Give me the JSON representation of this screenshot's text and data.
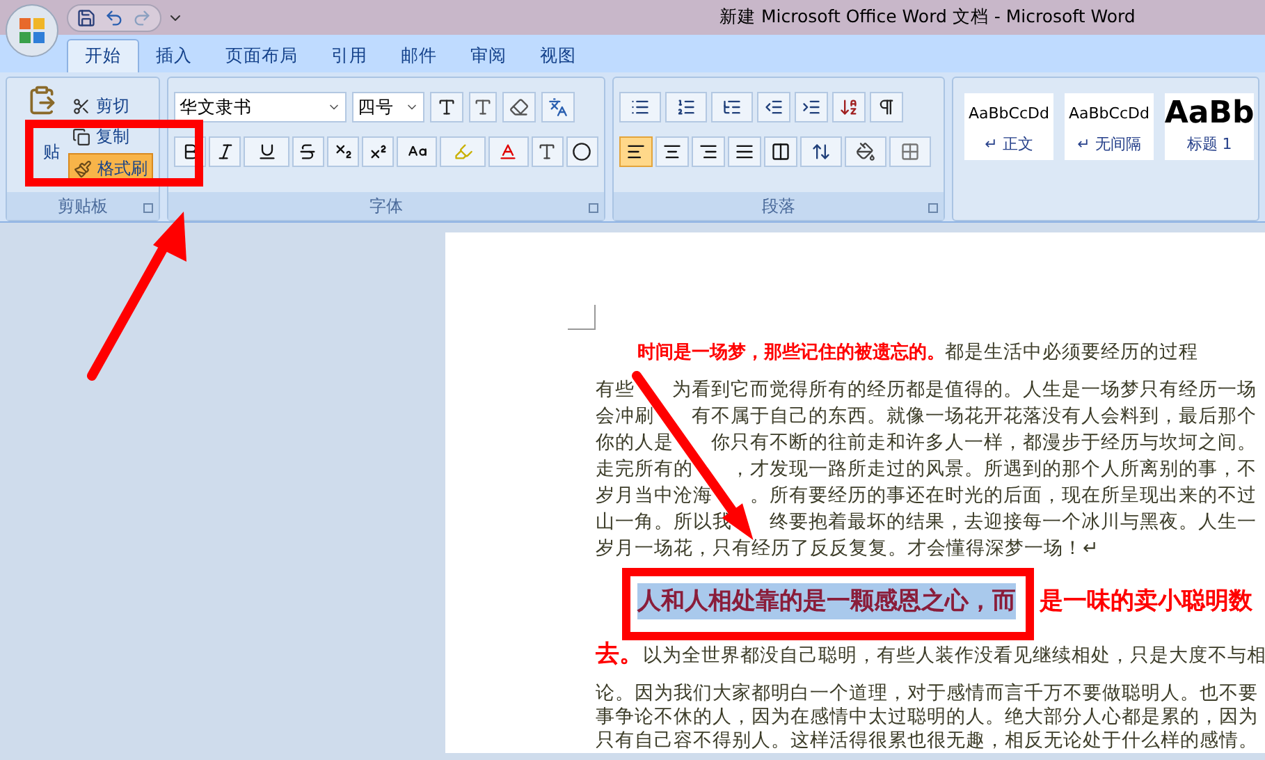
{
  "window": {
    "title": "新建 Microsoft Office Word 文档 - Microsoft Word"
  },
  "tabs": [
    {
      "label": "开始",
      "selected": true
    },
    {
      "label": "插入",
      "selected": false
    },
    {
      "label": "页面布局",
      "selected": false
    },
    {
      "label": "引用",
      "selected": false
    },
    {
      "label": "邮件",
      "selected": false
    },
    {
      "label": "审阅",
      "selected": false
    },
    {
      "label": "视图",
      "selected": false
    }
  ],
  "clipboard": {
    "label": "剪贴板",
    "paste": "贴",
    "cut": "剪切",
    "copy": "复制",
    "format_painter": {
      "label": "格式刷",
      "on": true
    }
  },
  "font": {
    "label": "字体",
    "font_name": "华文隶书",
    "font_size": "四号"
  },
  "paragraph": {
    "label": "段落",
    "align": [
      {
        "kind": "left",
        "selected": true
      },
      {
        "kind": "center",
        "selected": false
      },
      {
        "kind": "right",
        "selected": false
      },
      {
        "kind": "justify",
        "selected": false
      },
      {
        "kind": "distributed",
        "selected": false
      }
    ]
  },
  "styles": [
    {
      "kind": "normal",
      "mark": "↵",
      "sample": "AaBbCcDd",
      "name": "正文"
    },
    {
      "kind": "normal",
      "mark": "↵",
      "sample": "AaBbCcDd",
      "name": "无间隔"
    },
    {
      "kind": "heading",
      "sample": "AaBb",
      "name": "标题 1"
    }
  ],
  "document": {
    "paragraphs": [
      {
        "kind": "heading",
        "highlight": "时间是一场梦，那些记住的被遗忘的。",
        "lines": [
          "都是生活中必须要经历的过程"
        ]
      },
      {
        "kind": "overlaid",
        "lines": [
          [
            "有些",
            "为看到它而觉得所有的经历都是值得的。人生是一场梦只有经历一场"
          ],
          [
            "会冲刷",
            "有不属于自己的东西。就像一场花开花落没有人会料到，最后那个"
          ],
          [
            "你的人是",
            "你只有不断的往前走和许多人一样，都漫步于经历与坎坷之间。"
          ],
          [
            "走完所有的",
            "，才发现一路所走过的风景。所遇到的那个人所离别的事，不"
          ],
          [
            "岁月当中沧海",
            "。所有要经历的事还在时光的后面，现在所呈现出来的不过"
          ],
          [
            "山一角。所以我",
            "终要抱着最坏的结果，去迎接每一个冰川与黑夜。人生一"
          ],
          [
            "岁月一场花，只有经历了反反复复。才会懂得深梦一场！↵"
          ]
        ]
      },
      {
        "kind": "selected_heading",
        "selected_text": "人和人相处靠的是一颗感恩之心，而",
        "highlight": "是一味的卖小聪明数",
        "tail": "去。",
        "lines": [
          "以为全世界都没自己聪明，有些人装作没看见继续相处，只是大度不与相"
        ]
      },
      {
        "kind": "body",
        "lines": [
          "论。因为我们大家都明白一个道理，对于感情而言千万不要做聪明人。也不要",
          "事争论不休的人，因为在感情中太过聪明的人。绝大部分人心都是累的，因为",
          "只有自己容不得别人。这样活得很累也很无趣，相反无论处于什么样的感情。"
        ]
      }
    ]
  }
}
